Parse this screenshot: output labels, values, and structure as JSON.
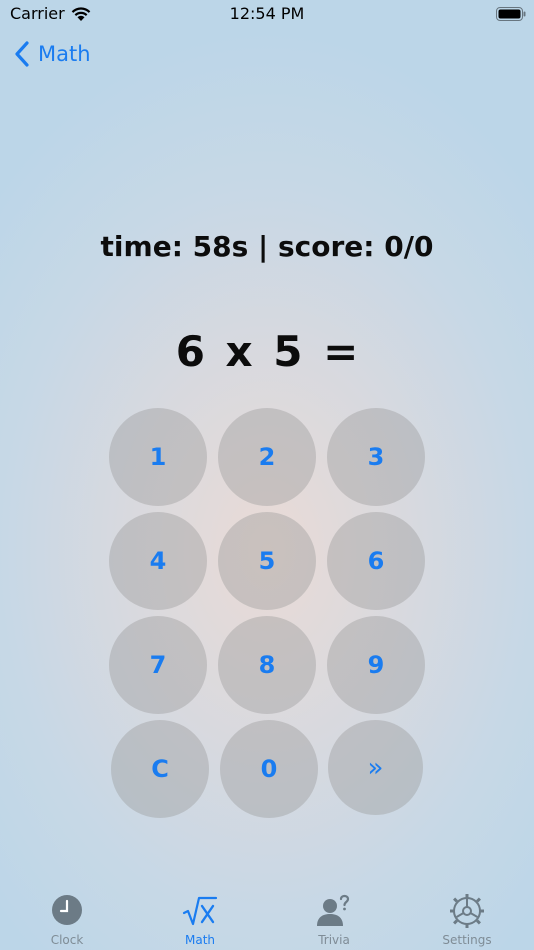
{
  "status_bar": {
    "carrier": "Carrier",
    "time": "12:54 PM"
  },
  "nav": {
    "back_label": "Math"
  },
  "game": {
    "status": "time: 58s | score: 0/0",
    "problem": "6 x 5 ="
  },
  "keypad": {
    "keys": [
      "1",
      "2",
      "3",
      "4",
      "5",
      "6",
      "7",
      "8",
      "9",
      "C",
      "0",
      "»"
    ]
  },
  "tabs": [
    {
      "label": "Clock",
      "icon": "clock-icon",
      "active": false
    },
    {
      "label": "Math",
      "icon": "square-root-icon",
      "active": true
    },
    {
      "label": "Trivia",
      "icon": "person-question-icon",
      "active": false
    },
    {
      "label": "Settings",
      "icon": "gear-icon",
      "active": false
    }
  ],
  "colors": {
    "accent": "#1a7cf0",
    "inactive_tab": "#7f8c96",
    "key_background": "rgba(150,150,150,0.38)"
  }
}
